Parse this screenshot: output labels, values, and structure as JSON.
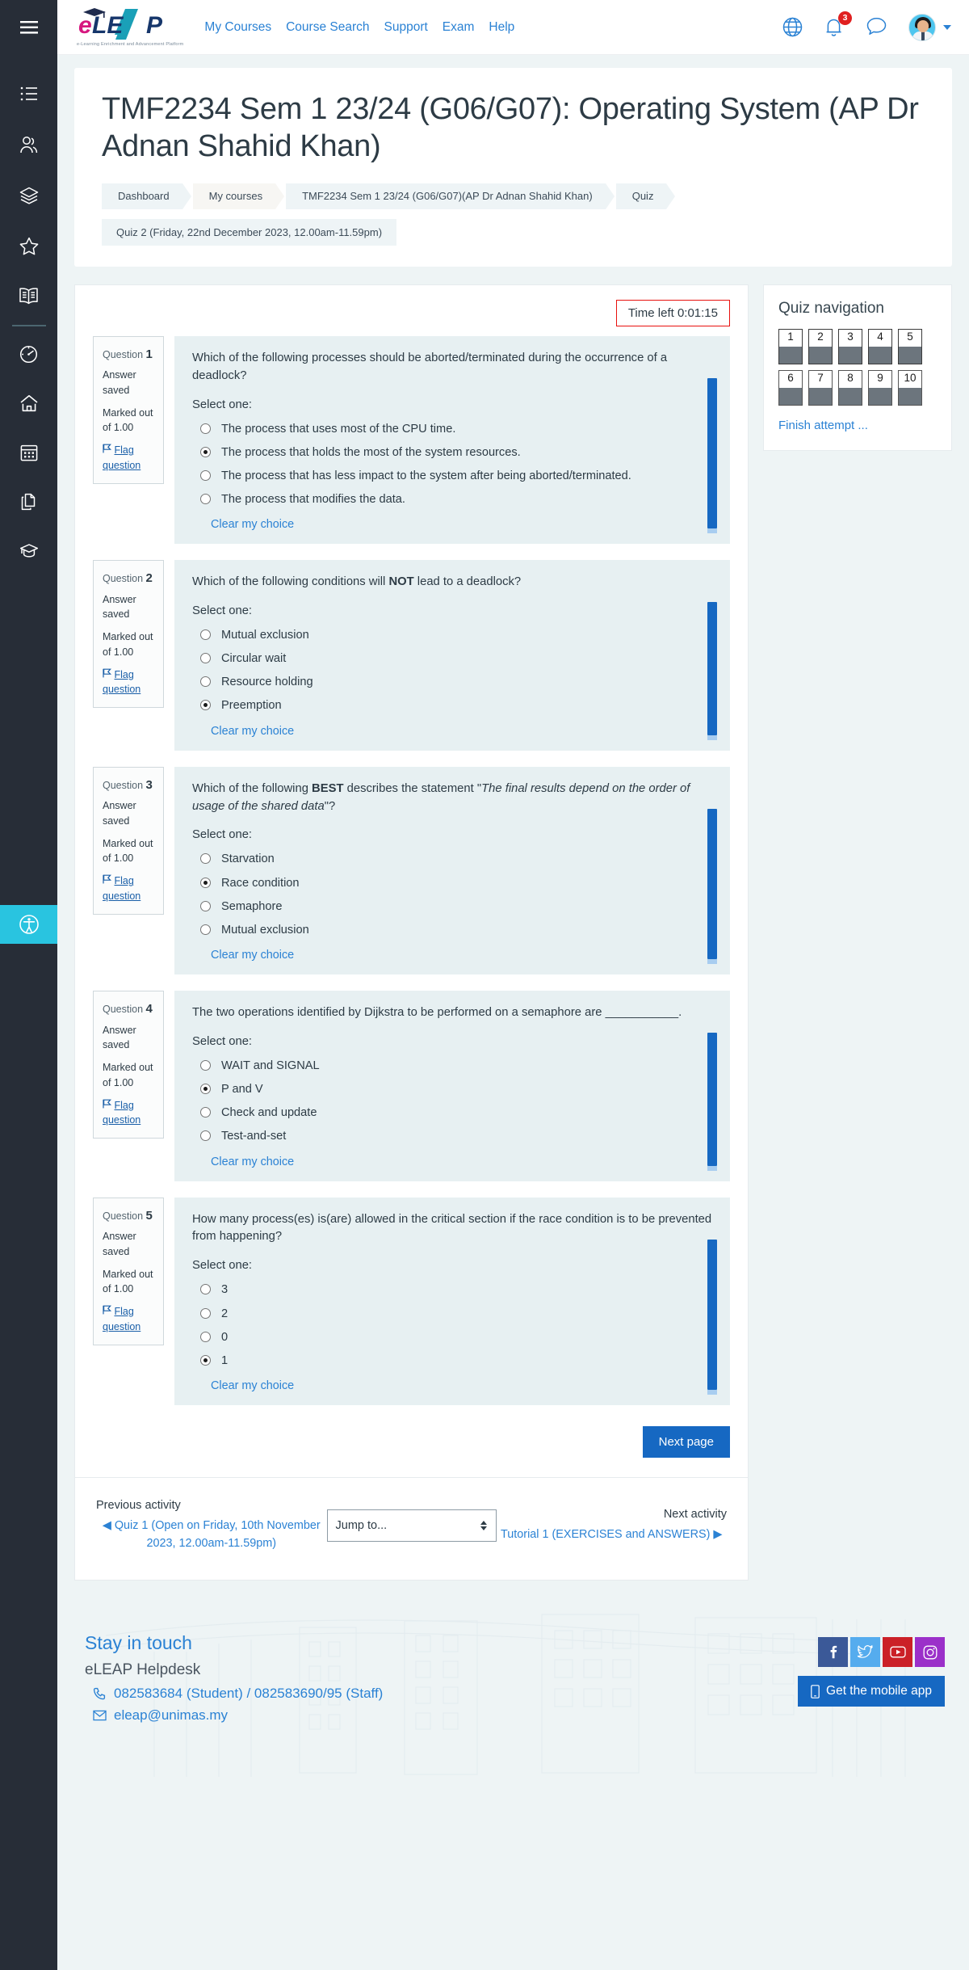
{
  "brand": {
    "name": "eLEAP",
    "tagline": "e-Learning Enrichment and Advancement Platform"
  },
  "topnav": [
    {
      "label": "My Courses"
    },
    {
      "label": "Course Search"
    },
    {
      "label": "Support"
    },
    {
      "label": "Exam"
    },
    {
      "label": "Help"
    }
  ],
  "top_right": {
    "language_icon": "globe-icon",
    "notifications_icon": "bell-icon",
    "notifications_count": "3",
    "messages_icon": "chat-bubble-icon",
    "avatar_icon": "user-avatar"
  },
  "sidebar": {
    "burger_icon": "hamburger-menu-icon",
    "items": [
      {
        "icon": "list-icon",
        "name": "list"
      },
      {
        "icon": "users-icon",
        "name": "participants"
      },
      {
        "icon": "layers-icon",
        "name": "layers"
      },
      {
        "icon": "star-icon",
        "name": "favourites"
      },
      {
        "icon": "book-icon",
        "name": "book"
      },
      {
        "icon": "gauge-icon",
        "name": "dashboard"
      },
      {
        "icon": "home-icon",
        "name": "site-home"
      },
      {
        "icon": "calendar-icon",
        "name": "calendar"
      },
      {
        "icon": "files-icon",
        "name": "private-files"
      },
      {
        "icon": "graduation-cap-icon",
        "name": "my-courses"
      }
    ],
    "accessibility_icon": "accessibility-icon"
  },
  "hero": {
    "title": "TMF2234 Sem 1 23/24 (G06/G07): Operating System (AP Dr Adnan Shahid Khan)",
    "breadcrumbs": [
      {
        "label": "Dashboard",
        "style": "normal"
      },
      {
        "label": "My courses",
        "style": "alt"
      },
      {
        "label": "TMF2234 Sem 1 23/24 (G06/G07)(AP Dr Adnan Shahid Khan)",
        "style": "normal"
      },
      {
        "label": "Quiz",
        "style": "normal"
      }
    ],
    "breadcrumb_second_row": "Quiz 2 (Friday, 22nd December 2023, 12.00am-11.59pm)"
  },
  "quiz": {
    "timer_label": "Time left 0:01:15",
    "select_one_label": "Select one:",
    "clear_choice_label": "Clear my choice",
    "flag_label": "Flag question",
    "answer_saved_label": "Answer saved",
    "marked_label": "Marked out of 1.00",
    "question_word": "Question",
    "next_page_label": "Next page",
    "questions": [
      {
        "number": "1",
        "text_html": "Which of the following processes should be aborted/terminated during the occurrence of a deadlock?",
        "options": [
          {
            "label": "The process that uses most of the CPU time.",
            "selected": false
          },
          {
            "label": "The process that holds the most of the system resources.",
            "selected": true
          },
          {
            "label": "The process that has less impact to the system after being aborted/terminated.",
            "selected": false
          },
          {
            "label": "The process that modifies the data.",
            "selected": false
          }
        ]
      },
      {
        "number": "2",
        "text_html": "Which of the following conditions will <b>NOT</b> lead to a deadlock?",
        "options": [
          {
            "label": "Mutual exclusion",
            "selected": false
          },
          {
            "label": "Circular wait",
            "selected": false
          },
          {
            "label": "Resource holding",
            "selected": false
          },
          {
            "label": "Preemption",
            "selected": true
          }
        ]
      },
      {
        "number": "3",
        "text_html": "Which of the following <b>BEST</b> describes the statement \"<i>The final results depend on the order of usage of the shared data</i>\"?",
        "options": [
          {
            "label": "Starvation",
            "selected": false
          },
          {
            "label": "Race condition",
            "selected": true
          },
          {
            "label": "Semaphore",
            "selected": false
          },
          {
            "label": "Mutual exclusion",
            "selected": false
          }
        ]
      },
      {
        "number": "4",
        "text_html": "The two operations identified by Dijkstra to be performed on a semaphore are ___________.",
        "options": [
          {
            "label": "WAIT and SIGNAL",
            "selected": false
          },
          {
            "label": "P and V",
            "selected": true
          },
          {
            "label": "Check and update",
            "selected": false
          },
          {
            "label": "Test-and-set",
            "selected": false
          }
        ]
      },
      {
        "number": "5",
        "text_html": "How many process(es) is(are) allowed in the critical section if the race condition is to be prevented from happening?",
        "options": [
          {
            "label": "3",
            "selected": false
          },
          {
            "label": "2",
            "selected": false
          },
          {
            "label": "0",
            "selected": false
          },
          {
            "label": "1",
            "selected": true
          }
        ]
      }
    ]
  },
  "quiz_nav": {
    "title": "Quiz navigation",
    "boxes": [
      {
        "label": "1",
        "current": true
      },
      {
        "label": "2",
        "current": true
      },
      {
        "label": "3",
        "current": true
      },
      {
        "label": "4",
        "current": true
      },
      {
        "label": "5",
        "current": true
      },
      {
        "label": "6",
        "current": false
      },
      {
        "label": "7",
        "current": false
      },
      {
        "label": "8",
        "current": false
      },
      {
        "label": "9",
        "current": false
      },
      {
        "label": "10",
        "current": false
      }
    ],
    "finish_label": "Finish attempt ..."
  },
  "activity_nav": {
    "previous_label": "Previous activity",
    "previous_link": "◀ Quiz 1 (Open on Friday, 10th November 2023, 12.00am-11.59pm)",
    "jump_placeholder": "Jump to...",
    "next_label": "Next activity",
    "next_link": "Tutorial 1 (EXERCISES and ANSWERS) ▶"
  },
  "footer": {
    "title": "Stay in touch",
    "subtitle": "eLEAP Helpdesk",
    "phone_icon": "phone-icon",
    "phone": "082583684 (Student) / 082583690/95 (Staff)",
    "email_icon": "envelope-icon",
    "email": "eleap@unimas.my",
    "socials": [
      {
        "name": "facebook-icon",
        "glyph": "f",
        "color": "#3b5998"
      },
      {
        "name": "twitter-icon",
        "glyph": "t",
        "color": "#55acee"
      },
      {
        "name": "youtube-icon",
        "glyph": "y",
        "color": "#cb2027"
      },
      {
        "name": "instagram-icon",
        "glyph": "i",
        "color": "#9b30c9"
      }
    ],
    "mobile_app_label": "Get the mobile app",
    "mobile_app_icon": "mobile-phone-icon"
  },
  "colors": {
    "accent_blue": "#1668c2",
    "link_blue": "#2b82d4",
    "sidebar_dark": "#272d37",
    "accessibility_teal": "#29c4e0",
    "question_bg": "#e7f0f2",
    "timer_red": "#e8110e"
  }
}
